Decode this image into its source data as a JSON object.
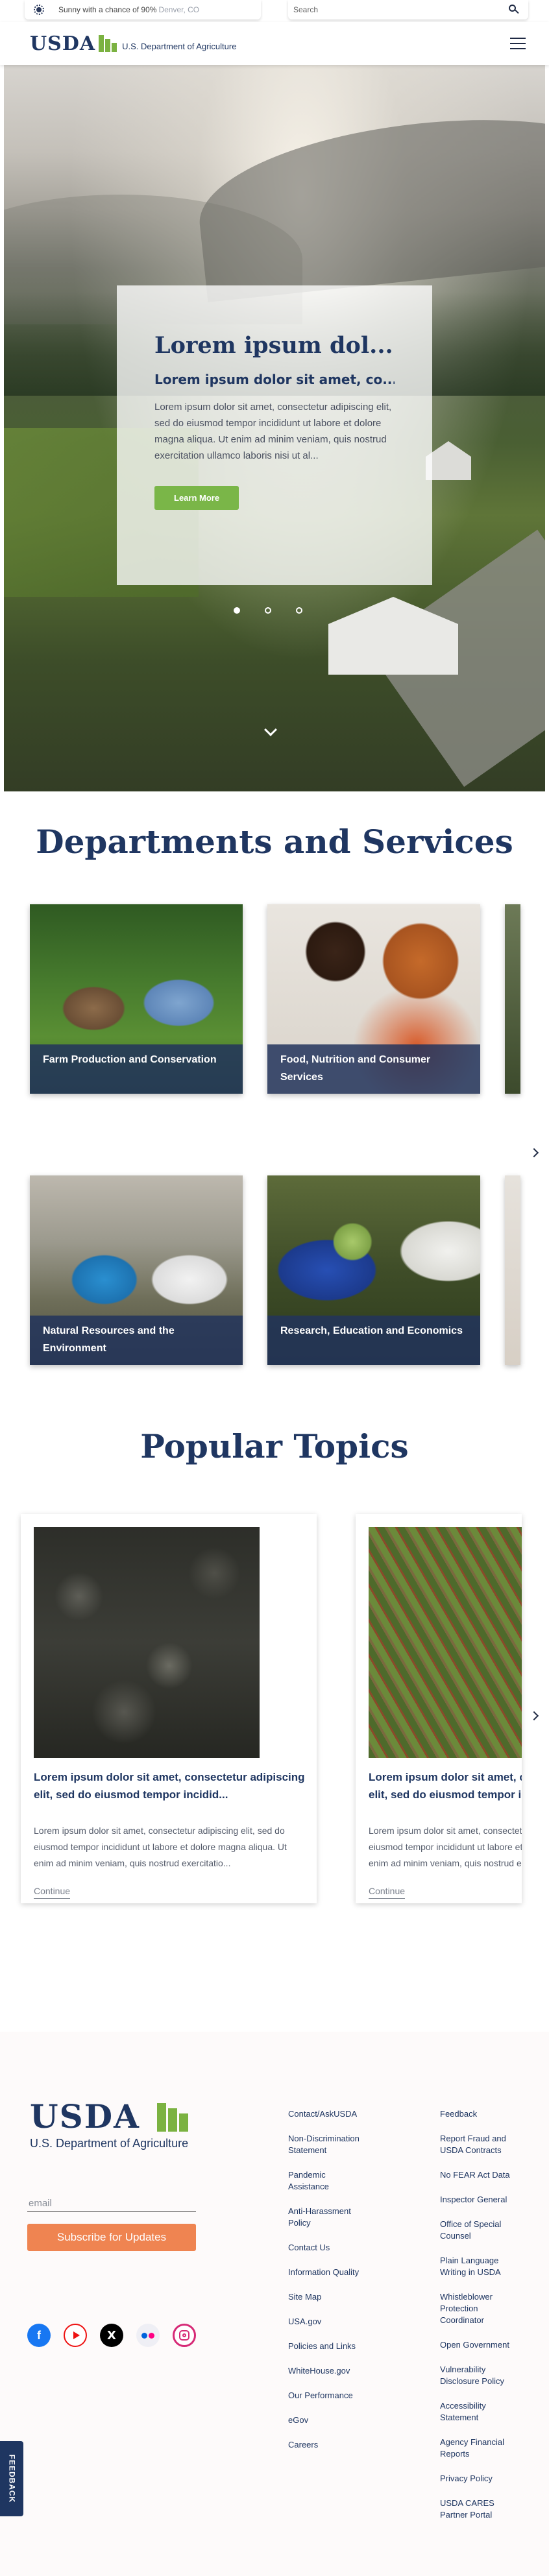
{
  "utility": {
    "weather_text": "Sunny with a chance of 90%",
    "weather_location": "Denver, CO",
    "search_placeholder": "Search"
  },
  "header": {
    "logo_word": "USDA",
    "logo_dept": "U.S. Department of Agriculture"
  },
  "hero": {
    "title": "Lorem ipsum dol...",
    "subtitle": "Lorem ipsum dolor sit amet, co...",
    "body": "Lorem ipsum dolor sit amet, consectetur adipiscing elit, sed do eiusmod tempor incididunt ut labore et dolore magna aliqua. Ut enim ad minim veniam, quis nostrud exercitation ullamco laboris nisi ut al...",
    "button_label": "Learn More",
    "slide_count": 3,
    "active_slide": 1
  },
  "departments": {
    "title": "Departments and Services",
    "cards": [
      {
        "label": "Farm Production and Conservation"
      },
      {
        "label": "Food, Nutrition and Consumer Services"
      },
      {
        "label": "Natural Resources and the Environment"
      },
      {
        "label": "Research, Education and Economics"
      }
    ]
  },
  "topics": {
    "title": "Popular Topics",
    "cards": [
      {
        "title": "Lorem ipsum dolor sit amet, consectetur adipiscing elit, sed do eiusmod tempor incidid...",
        "body": "Lorem ipsum dolor sit amet, consectetur adipiscing elit, sed do eiusmod tempor incididunt ut labore et dolore magna aliqua. Ut enim ad minim veniam, quis nostrud exercitatio...",
        "link": "Continue"
      },
      {
        "title": "Lorem ipsum dolor sit amet, consectetur adipiscing elit, sed do eiusmod tempor incidid...",
        "body": "Lorem ipsum dolor sit amet, consectetur adipiscing elit, sed do eiusmod tempor incididunt ut labore et dolore magna aliqua. Ut enim ad minim veniam, quis nostrud exercitatio...",
        "link": "Continue"
      }
    ]
  },
  "footer": {
    "logo_word": "USDA",
    "logo_dept": "U.S. Department of Agriculture",
    "email_placeholder": "email",
    "subscribe_label": "Subscribe for Updates",
    "social_x_glyph": "X",
    "links_col1": [
      "Contact/AskUSDA",
      "Non-Discrimination Statement",
      "Pandemic Assistance",
      "Anti-Harassment Policy",
      "Contact Us",
      "Information Quality",
      "Site Map",
      "USA.gov",
      "Policies and Links",
      "WhiteHouse.gov",
      "Our Performance",
      "eGov",
      "Careers"
    ],
    "links_col2": [
      "Feedback",
      "Report Fraud and USDA Contracts",
      "No FEAR Act Data",
      "Inspector General",
      "Office of Special Counsel",
      "Plain Language Writing in USDA",
      "Whistleblower Protection Coordinator",
      "Open Government",
      "Vulnerability Disclosure Policy",
      "Accessibility Statement",
      "Agency Financial Reports",
      "Privacy Policy",
      "USDA CARES Partner Portal"
    ],
    "feedback_tab": "FEEDBACK"
  },
  "colors": {
    "navy": "#1f3661",
    "usda_green": "#7bb241",
    "subscribe_orange": "#ef8451"
  }
}
